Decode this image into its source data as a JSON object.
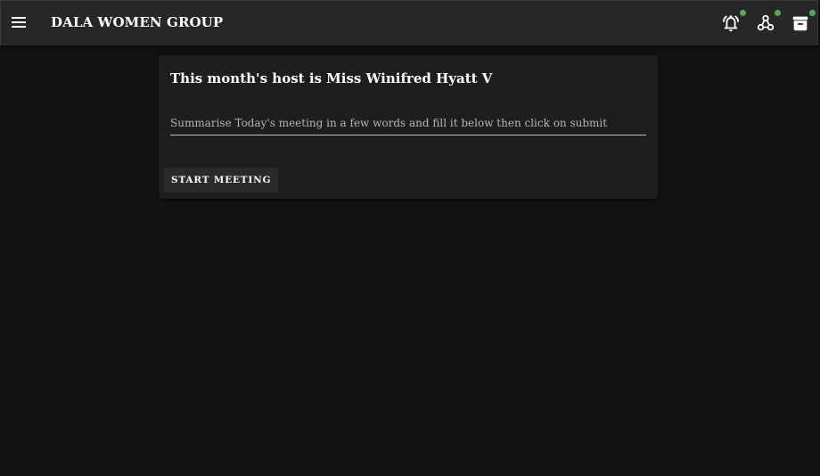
{
  "appbar": {
    "title": "DALA WOMEN GROUP",
    "menu_icon": "menu-icon",
    "actions": [
      {
        "icon": "bell-ring-icon",
        "has_badge": true
      },
      {
        "icon": "hub-icon",
        "has_badge": true
      },
      {
        "icon": "archive-icon",
        "has_badge": true
      }
    ],
    "badge_color": "#4caf50"
  },
  "card": {
    "title": "This month's host is Miss Winifred Hyatt V",
    "summary_placeholder": "Summarise Today's meeting in a few words and fill it below then click on submit",
    "summary_value": "",
    "start_button_label": "START MEETING"
  },
  "colors": {
    "background": "#121212",
    "appbar": "#272727",
    "card": "#1e1e1e"
  }
}
